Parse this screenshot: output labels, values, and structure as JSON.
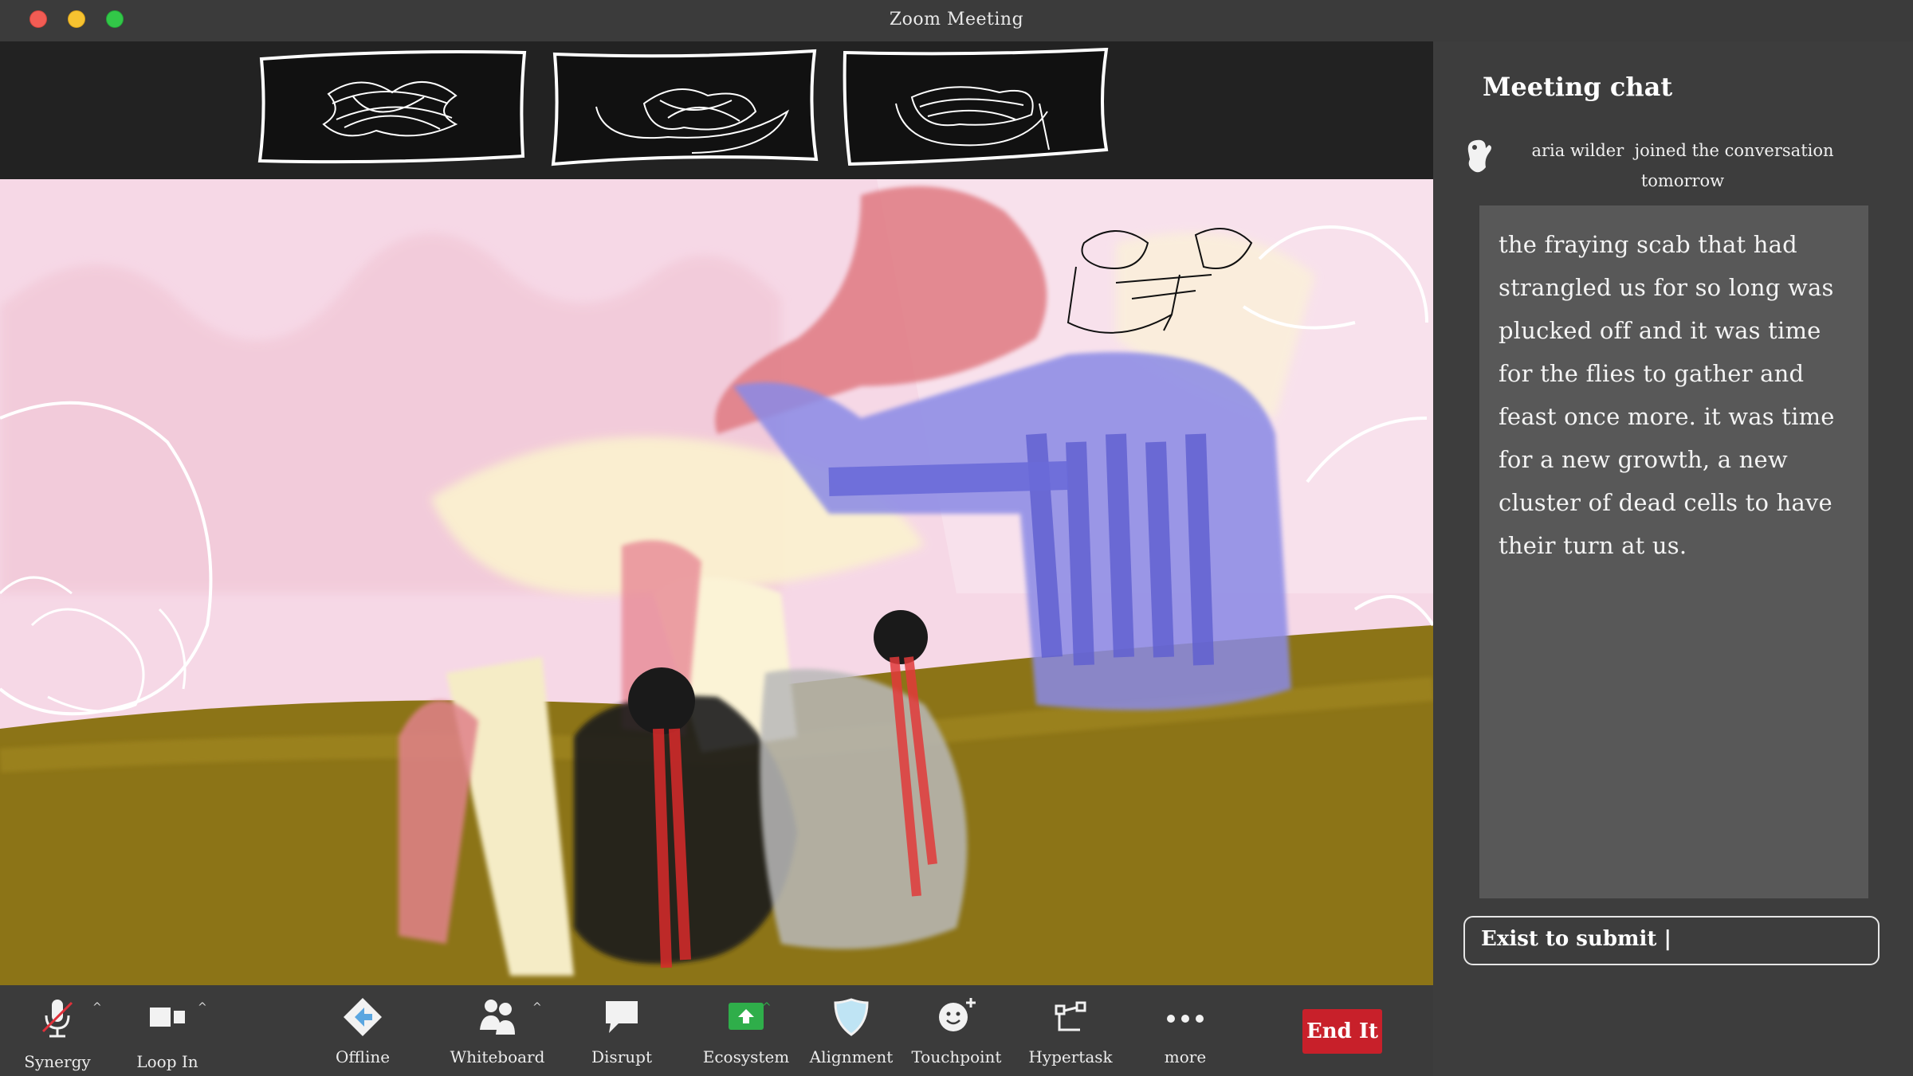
{
  "window": {
    "title": "Zoom Meeting"
  },
  "chat": {
    "title": "Meeting chat",
    "join_name": "aria wilder",
    "join_text": "joined the conversation",
    "join_when": "tomorrow",
    "message_lines": [
      "the fraying scab that had",
      "strangled us for so long was",
      "plucked off and it was time",
      "for the flies to gather and",
      "feast once more. it was time",
      "for a new growth, a new",
      "cluster of dead cells to have",
      "their turn at us."
    ],
    "input_value": "Exist to submit |"
  },
  "toolbar": {
    "synergy": "Synergy",
    "loop_in": "Loop In",
    "offline": "Offline",
    "whiteboard": "Whiteboard",
    "disrupt": "Disrupt",
    "ecosystem": "Ecosystem",
    "alignment": "Alignment",
    "touchpoint": "Touchpoint",
    "hypertask": "Hypertask",
    "more": "more",
    "end": "End It"
  },
  "colors": {
    "end_button": "#c8202a",
    "ecosystem_icon": "#2fae4a",
    "stage_pink": "#f6d6e6",
    "stage_olive": "#8c7417"
  }
}
